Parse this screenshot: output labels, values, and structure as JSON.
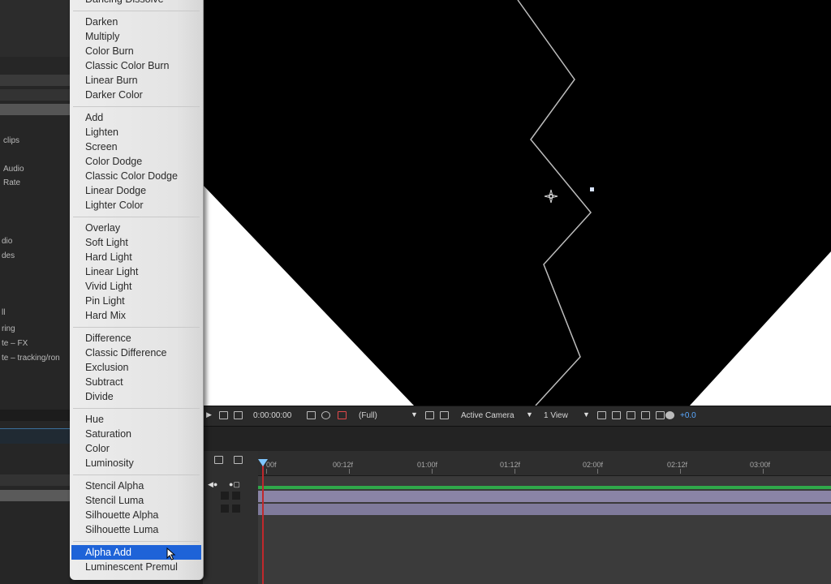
{
  "left_panel": {
    "items": [
      "clips",
      "Audio",
      "Rate",
      "dio",
      "des",
      "ll",
      "ring",
      "te – FX",
      "te – tracking/ron"
    ]
  },
  "blend_menu": {
    "groups": [
      [
        "Dancing Dissolve"
      ],
      [
        "Darken",
        "Multiply",
        "Color Burn",
        "Classic Color Burn",
        "Linear Burn",
        "Darker Color"
      ],
      [
        "Add",
        "Lighten",
        "Screen",
        "Color Dodge",
        "Classic Color Dodge",
        "Linear Dodge",
        "Lighter Color"
      ],
      [
        "Overlay",
        "Soft Light",
        "Hard Light",
        "Linear Light",
        "Vivid Light",
        "Pin Light",
        "Hard Mix"
      ],
      [
        "Difference",
        "Classic Difference",
        "Exclusion",
        "Subtract",
        "Divide"
      ],
      [
        "Hue",
        "Saturation",
        "Color",
        "Luminosity"
      ],
      [
        "Stencil Alpha",
        "Stencil Luma",
        "Silhouette Alpha",
        "Silhouette Luma"
      ],
      [
        "Alpha Add",
        "Luminescent Premul"
      ]
    ],
    "selected": "Alpha Add"
  },
  "viewer_toolbar": {
    "timecode": "0:00:00:00",
    "resolution": "(Full)",
    "camera": "Active Camera",
    "views": "1 View",
    "exposure": "+0.0"
  },
  "timeline": {
    "ruler_labels": [
      "00f",
      "00:12f",
      "01:00f",
      "01:12f",
      "02:00f",
      "02:12f",
      "03:00f"
    ]
  },
  "colors": {
    "menu_highlight": "#1e63d8",
    "playhead": "#c0282c",
    "playhead_marker": "#7fc6ff",
    "layer_bar_green": "#2fa84a",
    "layer_bar_purple": "#8a84a6",
    "exposure_value": "#5aa9ff"
  },
  "icons": {
    "cursor": "arrow-cursor-icon",
    "anchor": "anchor-point-icon",
    "camera_dropdown": "chevron-down-icon"
  }
}
